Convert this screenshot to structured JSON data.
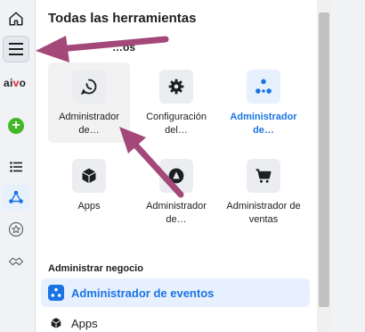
{
  "rail": {
    "brand": {
      "pre": "ai",
      "accent": "v",
      "post": "o"
    },
    "icons": [
      "home-icon",
      "menu-icon",
      "plus-icon",
      "list-icon",
      "events-icon",
      "star-icon",
      "handshake-icon"
    ]
  },
  "panel": {
    "title": "Todas las herramientas",
    "section_partial": "…os",
    "tiles": [
      {
        "label": "Administrador de…",
        "icon": "whatsapp-icon"
      },
      {
        "label": "Configuración del…",
        "icon": "gear-icon"
      },
      {
        "label": "Administrador de…",
        "icon": "events-icon"
      },
      {
        "label": "Apps",
        "icon": "cube-icon"
      },
      {
        "label": "Administrador de…",
        "icon": "ads-icon"
      },
      {
        "label": "Administrador de ventas",
        "icon": "cart-icon"
      }
    ],
    "business_section": {
      "title": "Administrar negocio",
      "items": [
        {
          "label": "Administrador de eventos",
          "icon": "events-icon"
        },
        {
          "label": "Apps",
          "icon": "cube-icon"
        }
      ]
    }
  },
  "colors": {
    "accent": "#1b74e4",
    "arrow": "#a4487a",
    "green": "#42b72a"
  }
}
